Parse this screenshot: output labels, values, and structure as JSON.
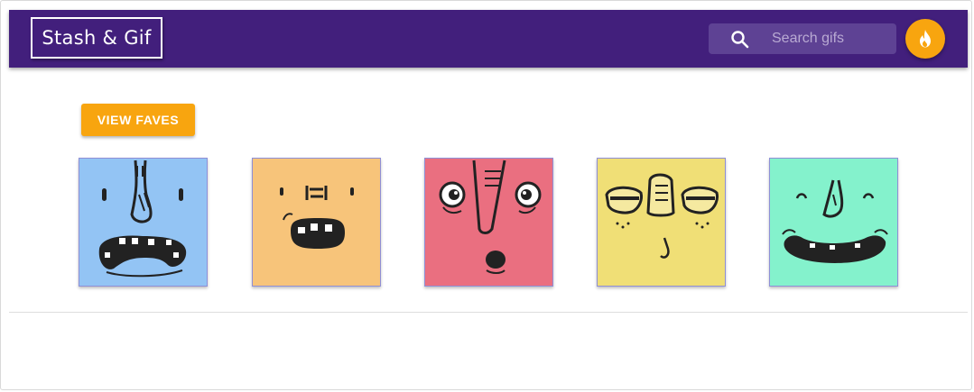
{
  "app": {
    "title": "Stash & Gif"
  },
  "search": {
    "placeholder": "Search gifs",
    "icon": "search-icon"
  },
  "actions": {
    "view_faves_label": "VIEW FAVES",
    "fire_icon": "fire-icon"
  },
  "colors": {
    "appbar": "#421f7c",
    "accent": "#f8a50f",
    "card_blue": "#93c4f4",
    "card_orange": "#f7c47a",
    "card_red": "#ea6f80",
    "card_yellow": "#f0df76",
    "card_green": "#84f2cc"
  },
  "gifs": [
    {
      "name": "blue-monster-face",
      "color": "#93c4f4"
    },
    {
      "name": "orange-monster-face",
      "color": "#f7c47a"
    },
    {
      "name": "red-monster-face",
      "color": "#ea6f80"
    },
    {
      "name": "yellow-monster-face",
      "color": "#f0df76"
    },
    {
      "name": "green-monster-face",
      "color": "#84f2cc"
    }
  ]
}
